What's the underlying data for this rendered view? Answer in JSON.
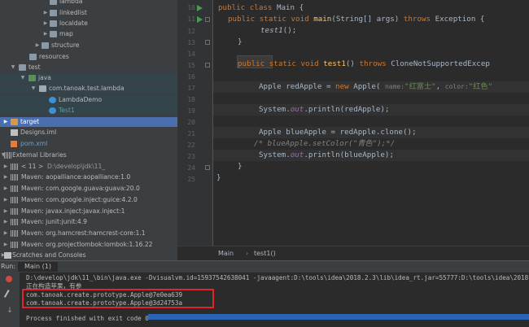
{
  "tree": {
    "rows": [
      {
        "label": "lambda",
        "icon": "folder"
      },
      {
        "label": "linkedlist",
        "icon": "folder"
      },
      {
        "label": "localdate",
        "icon": "folder"
      },
      {
        "label": "map",
        "icon": "folder"
      },
      {
        "label": "structure",
        "icon": "folder"
      },
      {
        "label": "resources",
        "icon": "folder"
      },
      {
        "label": "test",
        "icon": "folder"
      },
      {
        "label": "java",
        "icon": "folder"
      },
      {
        "label": "com.tanoak.test.lambda",
        "icon": "package"
      },
      {
        "label": "LambdaDemo",
        "icon": "class"
      },
      {
        "label": "Test1",
        "icon": "class"
      },
      {
        "label": "target",
        "icon": "folder"
      },
      {
        "label": "Designs.iml",
        "icon": "file"
      },
      {
        "label": "pom.xml",
        "icon": "xml"
      },
      {
        "label": "External Libraries",
        "icon": "libraries"
      },
      {
        "label": "< 11 >",
        "extra": "D:\\develop\\jdk\\11_",
        "icon": "jdk"
      },
      {
        "label": "Maven: aopalliance:aopalliance:1.0",
        "icon": "jar"
      },
      {
        "label": "Maven: com.google.guava:guava:20.0",
        "icon": "jar"
      },
      {
        "label": "Maven: com.google.inject:guice:4.2.0",
        "icon": "jar"
      },
      {
        "label": "Maven: javax.inject:javax.inject:1",
        "icon": "jar"
      },
      {
        "label": "Maven: junit:junit:4.9",
        "icon": "jar"
      },
      {
        "label": "Maven: org.hamcrest:hamcrest-core:1.1",
        "icon": "jar"
      },
      {
        "label": "Maven: org.projectlombok:lombok:1.16.22",
        "icon": "jar"
      },
      {
        "label": "Scratches and Consoles",
        "icon": "scratches"
      }
    ]
  },
  "editor": {
    "line_numbers": [
      "10",
      "11",
      "12",
      "13",
      "14",
      "15",
      "16",
      "17",
      "18",
      "19",
      "20",
      "21",
      "22",
      "23",
      "24",
      "25"
    ],
    "code": {
      "l10_kw1": "public",
      "l10_kw2": "class",
      "l10_rest": " Main {",
      "l11_kw1": "public",
      "l11_kw2": "static",
      "l11_kw3": "void",
      "l11_fn": "main",
      "l11_rest1": "(String[] args) ",
      "l11_kw4": "throws",
      "l11_rest2": " Exception {",
      "l12_call": "test1",
      "l12_rest": "();",
      "l13": "}",
      "l15_kw1": "public",
      "l15_kw2": "static",
      "l15_kw3": "void",
      "l15_fn": "test1",
      "l15_rest1": "() ",
      "l15_kw4": "throws",
      "l15_rest2": " CloneNotSupportedExcep",
      "l17_a": "Apple redApple = ",
      "l17_kw": "new",
      "l17_b": " Apple(",
      "l17_h1": "name:",
      "l17_s1": "\"红富士\"",
      "l17_c": ",",
      "l17_h2": "color:",
      "l17_s2": "\"红色\"",
      "l19_a": "System.",
      "l19_out": "out",
      "l19_b": ".println(redApple);",
      "l21_a": "Apple blueApple = redApple.clone();",
      "l22_comment": "/* blueApple.setColor(\"青色\");*/",
      "l23_a": "System.",
      "l23_out": "out",
      "l23_b": ".println(blueApple);",
      "l24": "}",
      "l25": "}"
    }
  },
  "breadcrumb": {
    "items": [
      "Main",
      "test1()"
    ]
  },
  "run": {
    "label": "Run:",
    "tab": "Main (1)",
    "output": [
      "D:\\develop\\jdk\\11_\\bin\\java.exe -Dvisualvm.id=15937542638041 -javaagent:D:\\tools\\idea\\2018.2.3\\lib\\idea_rt.jar=55777:D:\\tools\\idea\\2018.2",
      "正在构造苹果，有参",
      "com.tanoak.create.prototype.Apple@7e0ea639",
      "com.tanoak.create.prototype.Apple@3d24753a",
      "",
      "Process finished with exit code 0"
    ]
  },
  "colors": {
    "selection": "#4b6eaf",
    "keyword": "#cc7832",
    "function": "#ffc66d",
    "string": "#6a8759",
    "annotation_box": "#e0262b",
    "progress": "#2c64b5"
  }
}
